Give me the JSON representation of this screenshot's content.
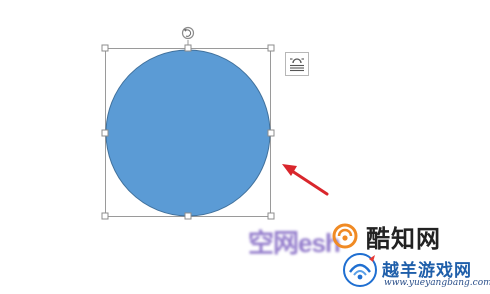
{
  "shape": {
    "type": "circle",
    "fill_color": "#5b9bd5",
    "outline_color": "#41719c",
    "state": "selected"
  },
  "selection": {
    "frame_color": "#9a9a9a",
    "handle_fill": "#ffffff",
    "handle_stroke": "#8c8c8c",
    "rotate_icon": "rotate-handle-icon"
  },
  "layout_options": {
    "icon": "layout-options-icon"
  },
  "annotation": {
    "arrow_color": "#d9262c"
  },
  "watermarks": {
    "blurred_text": "空网esh",
    "kuzhi": {
      "text": "酷知网",
      "logo_color": "#f08a24"
    },
    "yueyang": {
      "name": "越羊游戏网",
      "url": "www.yueyangbang.com",
      "logo_color": "#1f6fd1"
    }
  }
}
